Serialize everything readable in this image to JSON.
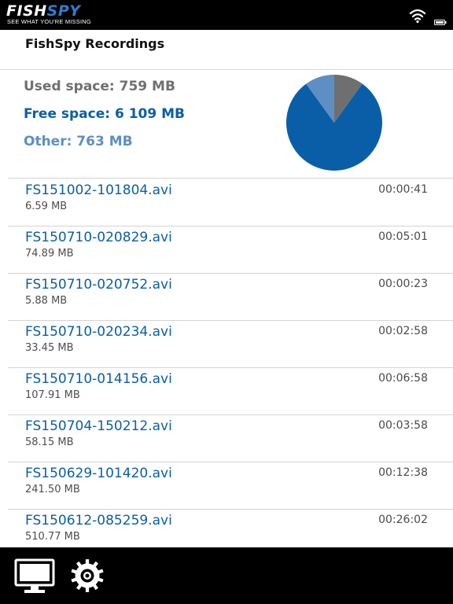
{
  "status_bar": {
    "logo_text_main": "FISH",
    "logo_text_accent": "SPY",
    "logo_tagline": "SEE WHAT YOU'RE MISSING",
    "icons": [
      "wifi-icon",
      "battery-icon"
    ]
  },
  "header": {
    "title": "FishSpy Recordings"
  },
  "storage": {
    "used_label": "Used space: 759 MB",
    "free_label": "Free space: 6 109 MB",
    "other_label": "Other: 763 MB",
    "colors": {
      "used": "#6f6f6f",
      "free": "#0a5ea8",
      "other": "#5d8fc4"
    }
  },
  "chart_data": {
    "type": "pie",
    "title": "",
    "slices": [
      {
        "name": "Used space",
        "value": 759,
        "color": "#6f6f6f"
      },
      {
        "name": "Free space",
        "value": 6109,
        "color": "#0a5ea8"
      },
      {
        "name": "Other",
        "value": 763,
        "color": "#5d8fc4"
      }
    ],
    "legend": "none"
  },
  "recordings": [
    {
      "name": "FS151002-101804.avi",
      "size": "6.59 MB",
      "duration": "00:00:41"
    },
    {
      "name": "FS150710-020829.avi",
      "size": "74.89 MB",
      "duration": "00:05:01"
    },
    {
      "name": "FS150710-020752.avi",
      "size": "5.88 MB",
      "duration": "00:00:23"
    },
    {
      "name": "FS150710-020234.avi",
      "size": "33.45 MB",
      "duration": "00:02:58"
    },
    {
      "name": "FS150710-014156.avi",
      "size": "107.91 MB",
      "duration": "00:06:58"
    },
    {
      "name": "FS150704-150212.avi",
      "size": "58.15 MB",
      "duration": "00:03:58"
    },
    {
      "name": "FS150629-101420.avi",
      "size": "241.50 MB",
      "duration": "00:12:38"
    },
    {
      "name": "FS150612-085259.avi",
      "size": "510.77 MB",
      "duration": "00:26:02"
    }
  ],
  "tabbar": {
    "tabs": [
      {
        "icon": "monitor-icon"
      },
      {
        "icon": "gear-icon"
      }
    ]
  }
}
